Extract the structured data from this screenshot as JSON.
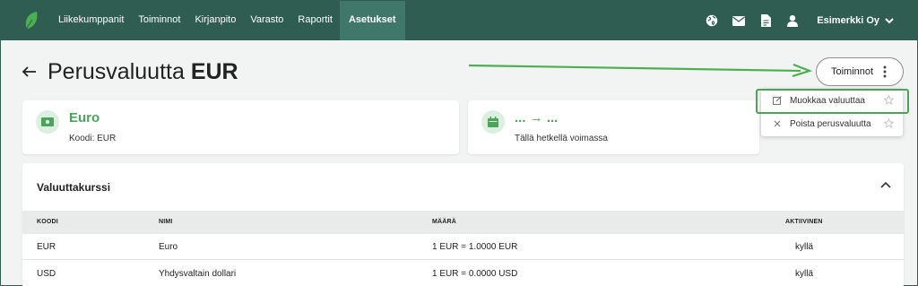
{
  "nav": {
    "logo_icon": "leaf-logo-icon",
    "items": [
      {
        "label": "Liikekumppanit",
        "active": false
      },
      {
        "label": "Toiminnot",
        "active": false
      },
      {
        "label": "Kirjanpito",
        "active": false
      },
      {
        "label": "Varasto",
        "active": false
      },
      {
        "label": "Raportit",
        "active": false
      },
      {
        "label": "Asetukset",
        "active": true
      }
    ],
    "right_icons": [
      "globe-icon",
      "mail-icon",
      "document-icon",
      "user-icon"
    ],
    "company": "Esimerkki Oy"
  },
  "page": {
    "title_prefix": "Perusvaluutta",
    "title_code": "EUR",
    "actions_label": "Toiminnot"
  },
  "currency_card": {
    "icon": "money-icon",
    "title": "Euro",
    "subtitle": "Koodi: EUR"
  },
  "validity_card": {
    "icon": "calendar-icon",
    "title": "... → ...",
    "subtitle": "Tällä hetkellä voimassa"
  },
  "actions_menu": {
    "items": [
      {
        "label": "Muokkaa valuuttaa",
        "icon": "edit-icon"
      },
      {
        "label": "Poista perusvaluutta",
        "icon": "close-icon"
      }
    ]
  },
  "rates": {
    "title": "Valuuttakurssi",
    "columns": [
      "KOODI",
      "NIMI",
      "MÄÄRÄ",
      "AKTIIVINEN"
    ],
    "rows": [
      [
        "EUR",
        "Euro",
        "1 EUR = 1.0000 EUR",
        "kyllä"
      ],
      [
        "USD",
        "Yhdysvaltain dollari",
        "1 EUR = 0.0000 USD",
        "kyllä"
      ]
    ]
  },
  "colors": {
    "nav_bg": "#2f5d52",
    "nav_active": "#3f786b",
    "accent_green": "#4ca45a",
    "page_bg": "#f2f3f3"
  }
}
